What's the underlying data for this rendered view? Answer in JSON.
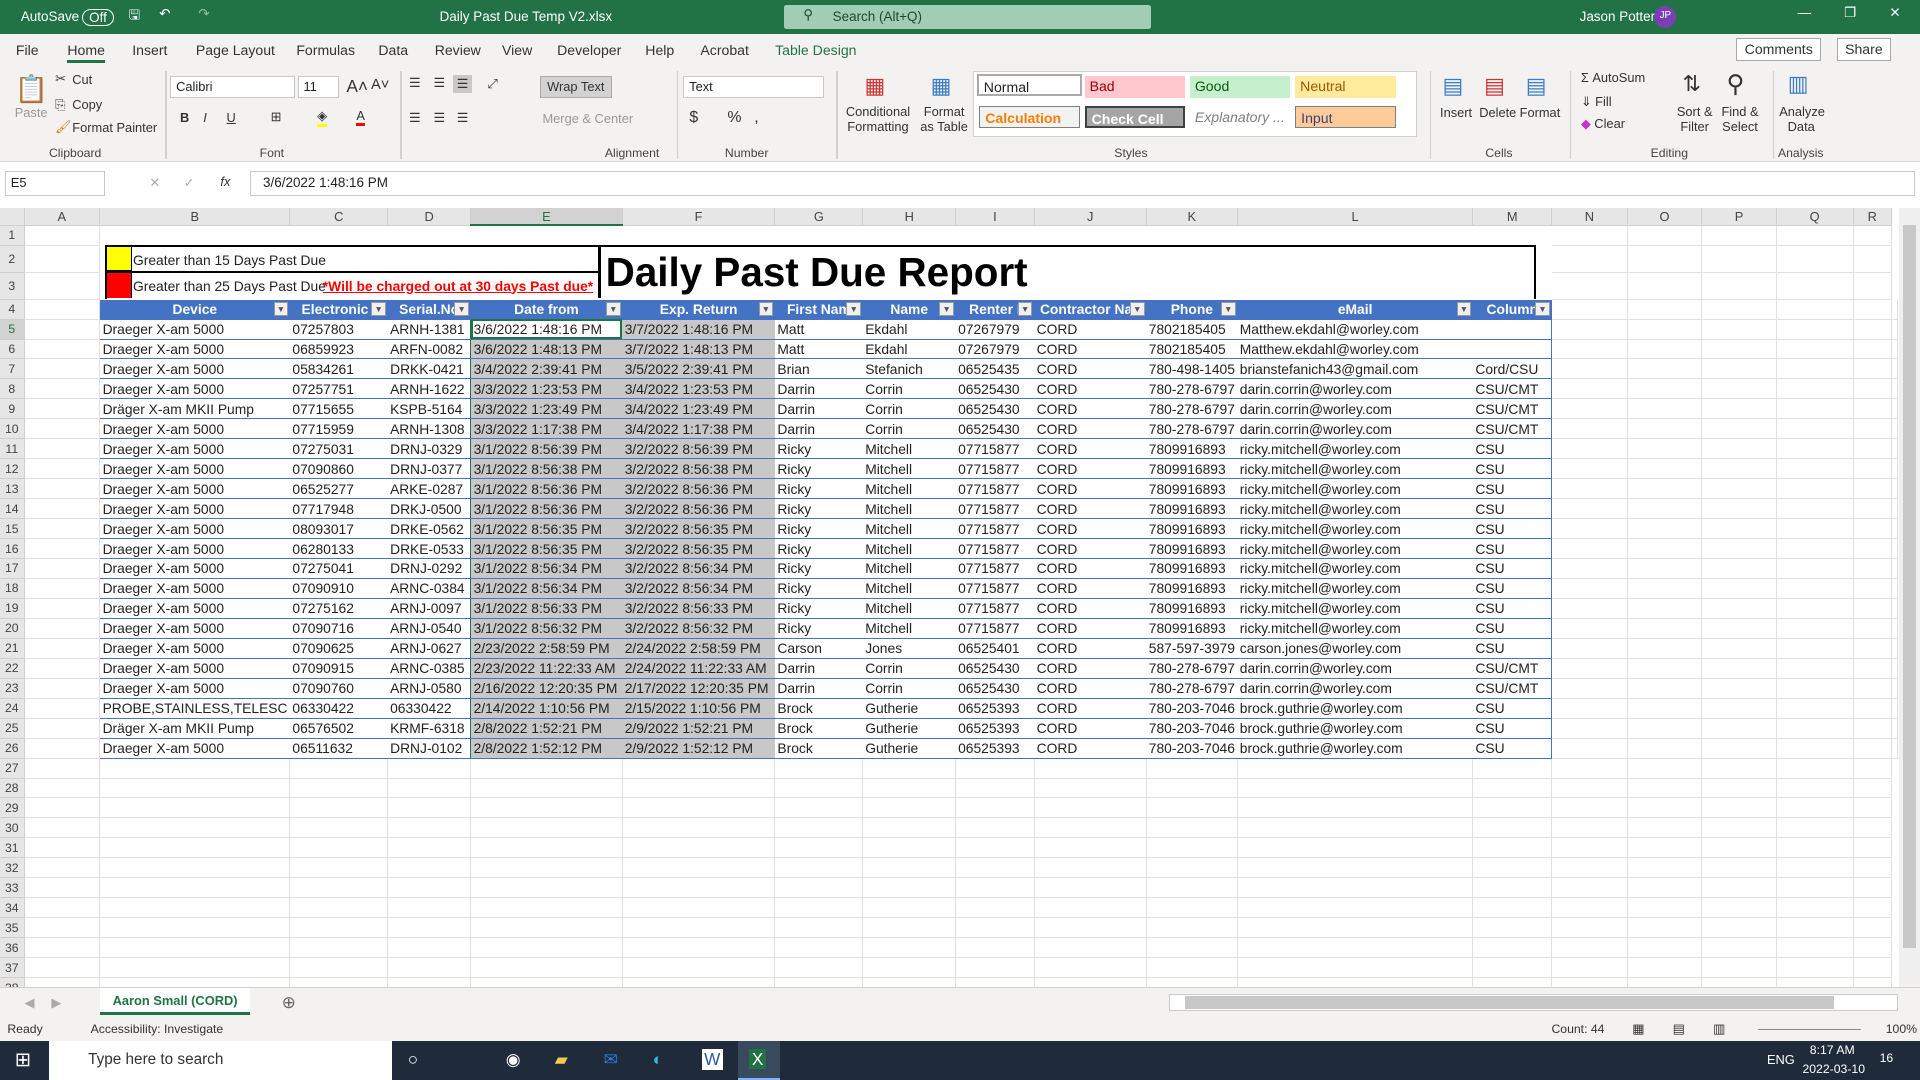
{
  "titlebar": {
    "autosave": "AutoSave",
    "autosave_state": "Off",
    "filename": "Daily Past Due Temp V2.xlsx",
    "search": "Search (Alt+Q)",
    "user": "Jason Potter",
    "initials": "JP"
  },
  "menu": [
    "File",
    "Home",
    "Insert",
    "Page Layout",
    "Formulas",
    "Data",
    "Review",
    "View",
    "Developer",
    "Help",
    "Acrobat",
    "Table Design"
  ],
  "menu_right": {
    "comments": "Comments",
    "share": "Share"
  },
  "ribbon": {
    "paste": "Paste",
    "cut": "Cut",
    "copy": "Copy",
    "format_painter": "Format Painter",
    "clipboard": "Clipboard",
    "font_name": "Calibri",
    "font_size": "11",
    "font": "Font",
    "wrap_text": "Wrap Text",
    "merge_center": "Merge & Center",
    "alignment": "Alignment",
    "number_format": "Text",
    "number": "Number",
    "conditional_formatting": "Conditional Formatting",
    "format_as_table": "Format as Table",
    "styles_label": "Styles",
    "styles": {
      "normal": "Normal",
      "bad": "Bad",
      "good": "Good",
      "neutral": "Neutral",
      "calculation": "Calculation",
      "check_cell": "Check Cell",
      "explanatory": "Explanatory ...",
      "input": "Input"
    },
    "insert": "Insert",
    "delete": "Delete",
    "format": "Format",
    "cells": "Cells",
    "autosum": "AutoSum",
    "fill": "Fill",
    "clear": "Clear",
    "sort_filter": "Sort & Filter",
    "find_select": "Find & Select",
    "editing": "Editing",
    "analyze_data": "Analyze Data",
    "analysis": "Analysis"
  },
  "formula_bar": {
    "name_box": "E5",
    "formula": "3/6/2022 1:48:16 PM"
  },
  "columns": [
    "A",
    "B",
    "C",
    "D",
    "E",
    "F",
    "G",
    "H",
    "I",
    "J",
    "K",
    "L",
    "M",
    "N",
    "O",
    "P",
    "Q",
    "R"
  ],
  "legend": {
    "yellow_label": "Greater than 15 Days Past Due",
    "red_label": "Greater than 25 Days Past Due",
    "warning": "*Will be charged out at 30 days Past due*",
    "yellow": "#ffff00",
    "red": "#ff0000"
  },
  "report_title": "Daily Past Due Report",
  "table": {
    "headers": [
      "Device",
      "Electronic I",
      "Serial.No",
      "Date from",
      "Exp. Return",
      "First Nam",
      "Name",
      "Renter I",
      "Contractor Nan",
      "Phone",
      "eMail",
      "Column"
    ],
    "rows": [
      [
        "Draeger X-am 5000",
        "07257803",
        "ARNH-1381",
        "3/6/2022 1:48:16 PM",
        "3/7/2022 1:48:16 PM",
        "Matt",
        "Ekdahl",
        "07267979",
        "CORD",
        "7802185405",
        "Matthew.ekdahl@worley.com",
        ""
      ],
      [
        "Draeger X-am 5000",
        "06859923",
        "ARFN-0082",
        "3/6/2022 1:48:13 PM",
        "3/7/2022 1:48:13 PM",
        "Matt",
        "Ekdahl",
        "07267979",
        "CORD",
        "7802185405",
        "Matthew.ekdahl@worley.com",
        ""
      ],
      [
        "Draeger X-am 5000",
        "05834261",
        "DRKK-0421",
        "3/4/2022 2:39:41 PM",
        "3/5/2022 2:39:41 PM",
        "Brian",
        "Stefanich",
        "06525435",
        "CORD",
        "780-498-1405",
        "brianstefanich43@gmail.com",
        "Cord/CSU"
      ],
      [
        "Draeger X-am 5000",
        "07257751",
        "ARNH-1622",
        "3/3/2022 1:23:53 PM",
        "3/4/2022 1:23:53 PM",
        "Darrin",
        "Corrin",
        "06525430",
        "CORD",
        "780-278-6797",
        "darin.corrin@worley.com",
        "CSU/CMT"
      ],
      [
        "Dräger X-am MKII Pump",
        "07715655",
        "KSPB-5164",
        "3/3/2022 1:23:49 PM",
        "3/4/2022 1:23:49 PM",
        "Darrin",
        "Corrin",
        "06525430",
        "CORD",
        "780-278-6797",
        "darin.corrin@worley.com",
        "CSU/CMT"
      ],
      [
        "Draeger X-am 5000",
        "07715959",
        "ARNH-1308",
        "3/3/2022 1:17:38 PM",
        "3/4/2022 1:17:38 PM",
        "Darrin",
        "Corrin",
        "06525430",
        "CORD",
        "780-278-6797",
        "darin.corrin@worley.com",
        "CSU/CMT"
      ],
      [
        "Draeger X-am 5000",
        "07275031",
        "DRNJ-0329",
        "3/1/2022 8:56:39 PM",
        "3/2/2022 8:56:39 PM",
        "Ricky",
        "Mitchell",
        "07715877",
        "CORD",
        "7809916893",
        "ricky.mitchell@worley.com",
        "CSU"
      ],
      [
        "Draeger X-am 5000",
        "07090860",
        "DRNJ-0377",
        "3/1/2022 8:56:38 PM",
        "3/2/2022 8:56:38 PM",
        "Ricky",
        "Mitchell",
        "07715877",
        "CORD",
        "7809916893",
        "ricky.mitchell@worley.com",
        "CSU"
      ],
      [
        "Draeger X-am 5000",
        "06525277",
        "ARKE-0287",
        "3/1/2022 8:56:36 PM",
        "3/2/2022 8:56:36 PM",
        "Ricky",
        "Mitchell",
        "07715877",
        "CORD",
        "7809916893",
        "ricky.mitchell@worley.com",
        "CSU"
      ],
      [
        "Draeger X-am 5000",
        "07717948",
        "DRKJ-0500",
        "3/1/2022 8:56:36 PM",
        "3/2/2022 8:56:36 PM",
        "Ricky",
        "Mitchell",
        "07715877",
        "CORD",
        "7809916893",
        "ricky.mitchell@worley.com",
        "CSU"
      ],
      [
        "Draeger X-am 5000",
        "08093017",
        "DRKE-0562",
        "3/1/2022 8:56:35 PM",
        "3/2/2022 8:56:35 PM",
        "Ricky",
        "Mitchell",
        "07715877",
        "CORD",
        "7809916893",
        "ricky.mitchell@worley.com",
        "CSU"
      ],
      [
        "Draeger X-am 5000",
        "06280133",
        "DRKE-0533",
        "3/1/2022 8:56:35 PM",
        "3/2/2022 8:56:35 PM",
        "Ricky",
        "Mitchell",
        "07715877",
        "CORD",
        "7809916893",
        "ricky.mitchell@worley.com",
        "CSU"
      ],
      [
        "Draeger X-am 5000",
        "07275041",
        "DRNJ-0292",
        "3/1/2022 8:56:34 PM",
        "3/2/2022 8:56:34 PM",
        "Ricky",
        "Mitchell",
        "07715877",
        "CORD",
        "7809916893",
        "ricky.mitchell@worley.com",
        "CSU"
      ],
      [
        "Draeger X-am 5000",
        "07090910",
        "ARNC-0384",
        "3/1/2022 8:56:34 PM",
        "3/2/2022 8:56:34 PM",
        "Ricky",
        "Mitchell",
        "07715877",
        "CORD",
        "7809916893",
        "ricky.mitchell@worley.com",
        "CSU"
      ],
      [
        "Draeger X-am 5000",
        "07275162",
        "ARNJ-0097",
        "3/1/2022 8:56:33 PM",
        "3/2/2022 8:56:33 PM",
        "Ricky",
        "Mitchell",
        "07715877",
        "CORD",
        "7809916893",
        "ricky.mitchell@worley.com",
        "CSU"
      ],
      [
        "Draeger X-am 5000",
        "07090716",
        "ARNJ-0540",
        "3/1/2022 8:56:32 PM",
        "3/2/2022 8:56:32 PM",
        "Ricky",
        "Mitchell",
        "07715877",
        "CORD",
        "7809916893",
        "ricky.mitchell@worley.com",
        "CSU"
      ],
      [
        "Draeger X-am 5000",
        "07090625",
        "ARNJ-0627",
        "2/23/2022 2:58:59 PM",
        "2/24/2022 2:58:59 PM",
        "Carson",
        "Jones",
        "06525401",
        "CORD",
        "587-597-3979",
        "carson.jones@worley.com",
        "CSU"
      ],
      [
        "Draeger X-am 5000",
        "07090915",
        "ARNC-0385",
        "2/23/2022 11:22:33 AM",
        "2/24/2022 11:22:33 AM",
        "Darrin",
        "Corrin",
        "06525430",
        "CORD",
        "780-278-6797",
        "darin.corrin@worley.com",
        "CSU/CMT"
      ],
      [
        "Draeger X-am 5000",
        "07090760",
        "ARNJ-0580",
        "2/16/2022 12:20:35 PM",
        "2/17/2022 12:20:35 PM",
        "Darrin",
        "Corrin",
        "06525430",
        "CORD",
        "780-278-6797",
        "darin.corrin@worley.com",
        "CSU/CMT"
      ],
      [
        "PROBE,STAINLESS,TELESC",
        "06330422",
        "06330422",
        "2/14/2022 1:10:56 PM",
        "2/15/2022 1:10:56 PM",
        "Brock",
        "Gutherie",
        "06525393",
        "CORD",
        "780-203-7046",
        "brock.guthrie@worley.com",
        "CSU"
      ],
      [
        "Dräger X-am MKII Pump",
        "06576502",
        "KRMF-6318",
        "2/8/2022 1:52:21 PM",
        "2/9/2022 1:52:21 PM",
        "Brock",
        "Gutherie",
        "06525393",
        "CORD",
        "780-203-7046",
        "brock.guthrie@worley.com",
        "CSU"
      ],
      [
        "Draeger X-am 5000",
        "06511632",
        "DRNJ-0102",
        "2/8/2022 1:52:12 PM",
        "2/9/2022 1:52:12 PM",
        "Brock",
        "Gutherie",
        "06525393",
        "CORD",
        "780-203-7046",
        "brock.guthrie@worley.com",
        "CSU"
      ]
    ]
  },
  "sheet_tab": "Aaron Small (CORD)",
  "status": {
    "ready": "Ready",
    "accessibility": "Accessibility: Investigate",
    "count": "Count: 44",
    "zoom": "100%"
  },
  "taskbar": {
    "search": "Type here to search",
    "lang": "ENG",
    "time": "8:17 AM",
    "date": "2022-03-10",
    "notif": "16"
  },
  "colors": {
    "excel_green": "#217346",
    "table_header": "#4472c4",
    "date_fill": "#c8c8c8"
  }
}
